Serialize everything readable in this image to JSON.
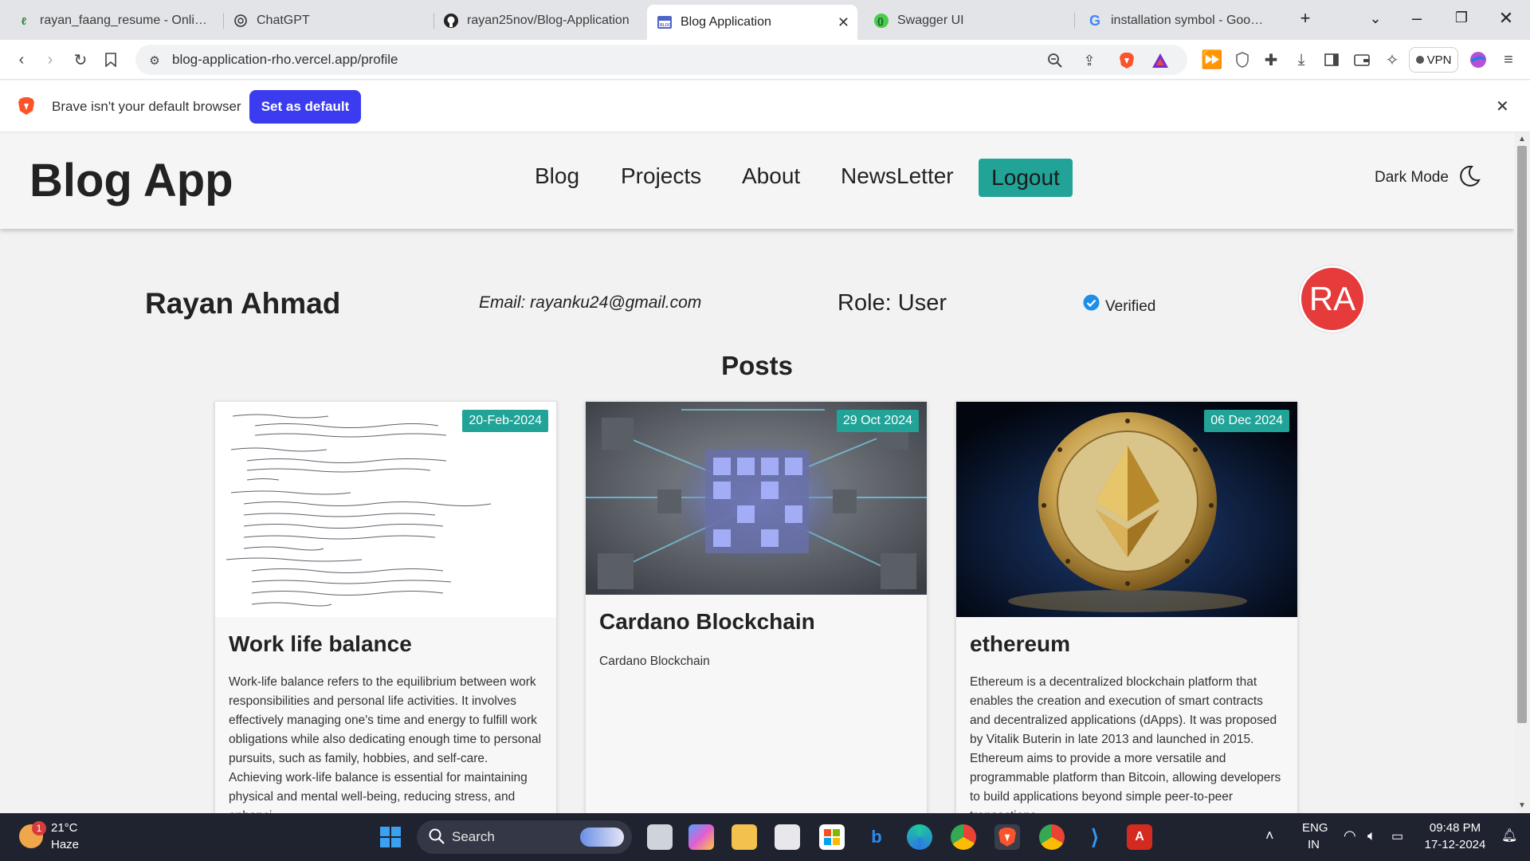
{
  "browser": {
    "tabs": [
      {
        "title": "rayan_faang_resume - Online La",
        "icon": "overleaf-icon"
      },
      {
        "title": "ChatGPT",
        "icon": "chatgpt-icon"
      },
      {
        "title": "rayan25nov/Blog-Application",
        "icon": "github-icon"
      },
      {
        "title": "Blog Application",
        "icon": "blog-icon",
        "active": true
      },
      {
        "title": "Swagger UI",
        "icon": "swagger-icon"
      },
      {
        "title": "installation symbol - Google Se",
        "icon": "google-icon"
      }
    ],
    "url": "blog-application-rho.vercel.app/profile",
    "vpn_label": "VPN"
  },
  "infobar": {
    "message": "Brave isn't your default browser",
    "button_label": "Set as default"
  },
  "navbar": {
    "brand": "Blog App",
    "links": [
      "Blog",
      "Projects",
      "About",
      "NewsLetter"
    ],
    "logout_label": "Logout",
    "dark_mode_label": "Dark Mode"
  },
  "profile": {
    "name": "Rayan Ahmad",
    "email": "Email: rayanku24@gmail.com",
    "role": "Role: User",
    "verified_label": "Verified",
    "avatar_initials": "RA"
  },
  "posts": {
    "heading": "Posts",
    "items": [
      {
        "date": "20-Feb-2024",
        "title": "Work life balance",
        "body": "Work-life balance refers to the equilibrium between work responsibilities and personal life activities. It involves effectively managing one's time and energy to fulfill work obligations while also dedicating enough time to personal pursuits, such as family, hobbies, and self-care. Achieving work-life balance is essential for maintaining physical and mental well-being, reducing stress, and enhanci"
      },
      {
        "date": "29 Oct 2024",
        "title": "Cardano Blockchain",
        "body": "Cardano Blockchain"
      },
      {
        "date": "06 Dec 2024",
        "title": "ethereum",
        "body": "Ethereum is a decentralized blockchain platform that enables the creation and execution of smart contracts and decentralized applications (dApps). It was proposed by Vitalik Buterin in late 2013 and launched in 2015. Ethereum aims to provide a more versatile and programmable platform than Bitcoin, allowing developers to build applications beyond simple peer-to-peer transactions."
      }
    ]
  },
  "taskbar": {
    "temperature": "21°C",
    "condition": "Haze",
    "notification_count": "1",
    "search_label": "Search",
    "language": "ENG",
    "region": "IN",
    "time": "09:48 PM",
    "date": "17-12-2024"
  },
  "colors": {
    "accent_teal": "#22a398",
    "avatar_red": "#e53b3b",
    "brave_blue": "#3b3bf0"
  }
}
